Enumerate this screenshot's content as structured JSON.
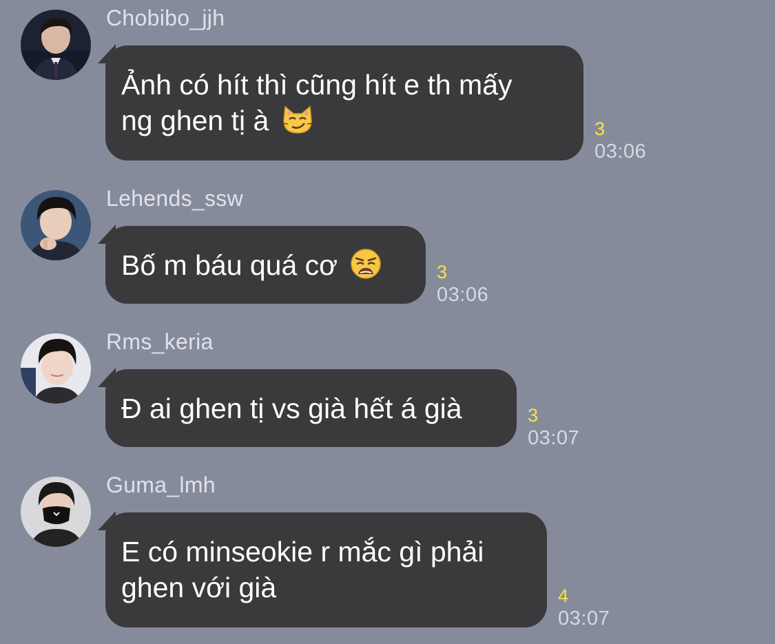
{
  "chat": {
    "messages": [
      {
        "sender": "Chobibo_jjh",
        "text": "Ảnh có hít thì cũng hít e th mấy\nng ghen tị à",
        "emoji": "smirking-cat-face",
        "read_count": "3",
        "time": "03:06"
      },
      {
        "sender": "Lehends_ssw",
        "text": "Bố m báu quá cơ",
        "emoji": "weary-face",
        "read_count": "3",
        "time": "03:06"
      },
      {
        "sender": "Rms_keria",
        "text": "Đ ai ghen tị vs già hết á già",
        "emoji": "",
        "read_count": "3",
        "time": "03:07"
      },
      {
        "sender": "Guma_lmh",
        "text": "E có minseokie r mắc gì phải\nghen với già",
        "emoji": "",
        "read_count": "4",
        "time": "03:07"
      }
    ]
  },
  "colors": {
    "background": "#868b9c",
    "bubble": "#3a3a3c",
    "read_count": "#f5e443",
    "timestamp": "#d6d9e2",
    "sender_name": "#dfe2ea"
  }
}
